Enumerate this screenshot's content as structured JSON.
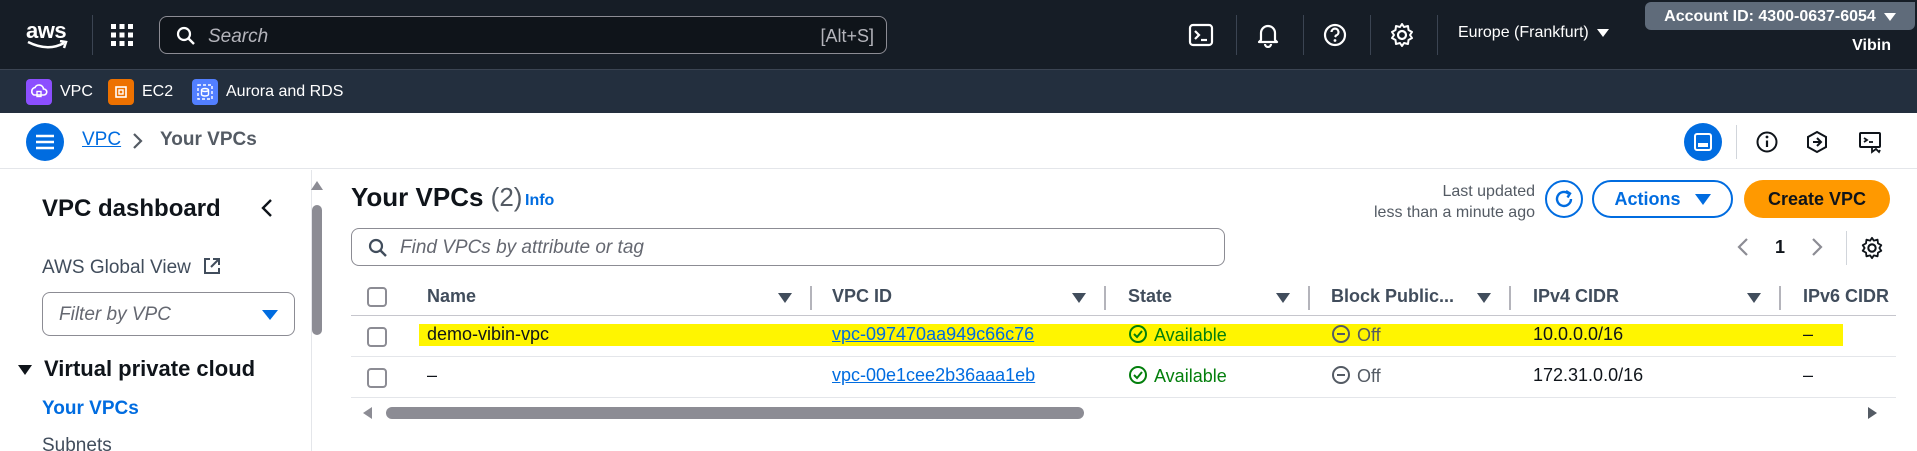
{
  "topnav": {
    "logo": "aws",
    "search_placeholder": "Search",
    "search_shortcut": "[Alt+S]",
    "region": "Europe (Frankfurt)",
    "account": "Account ID: 4300-0637-6054",
    "user": "Vibin",
    "icons": [
      "apps-grid-icon",
      "cloudshell-icon",
      "bell-icon",
      "help-icon",
      "gear-icon"
    ]
  },
  "favorites": [
    {
      "label": "VPC",
      "color": "#8c4fff"
    },
    {
      "label": "EC2",
      "color": "#ed7100"
    },
    {
      "label": "Aurora and RDS",
      "color": "#527fff"
    }
  ],
  "breadcrumb": {
    "root": "VPC",
    "current": "Your VPCs"
  },
  "sidebar": {
    "title": "VPC dashboard",
    "global_view": "AWS Global View",
    "filter_placeholder": "Filter by VPC",
    "section": "Virtual private cloud",
    "items": [
      "Your VPCs",
      "Subnets"
    ]
  },
  "main": {
    "title": "Your VPCs",
    "count": "(2)",
    "info": "Info",
    "last_updated_line1": "Last updated",
    "last_updated_line2": "less than a minute ago",
    "actions_label": "Actions",
    "create_label": "Create VPC",
    "find_placeholder": "Find VPCs by attribute or tag",
    "page": "1"
  },
  "table": {
    "columns": [
      "Name",
      "VPC ID",
      "State",
      "Block Public...",
      "IPv4 CIDR",
      "IPv6 CIDR"
    ],
    "rows": [
      {
        "name": "demo-vibin-vpc",
        "vpc_id": "vpc-097470aa949c66c76",
        "state": "Available",
        "block": "Off",
        "ipv4": "10.0.0.0/16",
        "ipv6": "–",
        "highlighted": true
      },
      {
        "name": "–",
        "vpc_id": "vpc-00e1cee2b36aaa1eb",
        "state": "Available",
        "block": "Off",
        "ipv4": "172.31.0.0/16",
        "ipv6": "–",
        "highlighted": false
      }
    ]
  },
  "colors": {
    "nav_bg": "#161d26",
    "fav_bg": "#232f3e",
    "link": "#006ce0",
    "primary_button": "#ff9900",
    "status_ok": "#037f0c",
    "highlight": "#fff500"
  }
}
